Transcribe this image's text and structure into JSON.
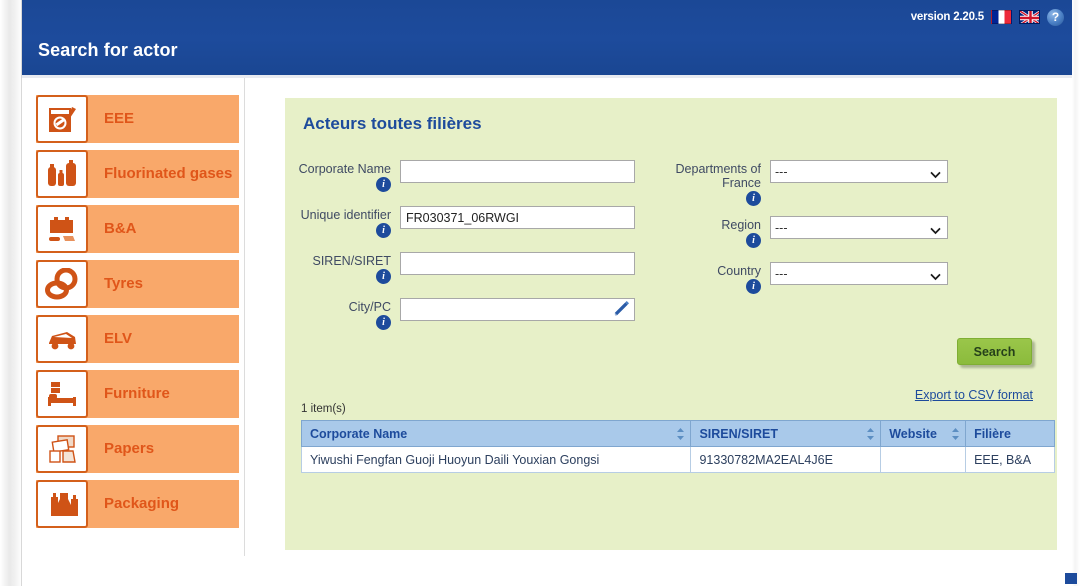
{
  "header": {
    "version_text": "version 2.20.5",
    "title": "Search for actor",
    "flag_fr_name": "french-flag-icon",
    "flag_uk_name": "uk-flag-icon",
    "help_glyph": "?"
  },
  "sidebar": {
    "items": [
      {
        "label": "EEE",
        "icon": "washing-machine-icon"
      },
      {
        "label": "Fluorinated gases",
        "icon": "gas-cylinder-icon"
      },
      {
        "label": "B&A",
        "icon": "battery-icon"
      },
      {
        "label": "Tyres",
        "icon": "tyre-icon"
      },
      {
        "label": "ELV",
        "icon": "car-icon"
      },
      {
        "label": "Furniture",
        "icon": "bed-icon"
      },
      {
        "label": "Papers",
        "icon": "paper-icon"
      },
      {
        "label": "Packaging",
        "icon": "bottles-icon"
      }
    ]
  },
  "panel": {
    "title": "Acteurs toutes filières",
    "fields_left": [
      {
        "label": "Corporate Name",
        "value": "",
        "placeholder": ""
      },
      {
        "label": "Unique identifier",
        "value": "FR030371_06RWGI",
        "placeholder": ""
      },
      {
        "label": "SIREN/SIRET",
        "value": "",
        "placeholder": ""
      },
      {
        "label": "City/PC",
        "value": "",
        "placeholder": ""
      }
    ],
    "fields_right": [
      {
        "label": "Departments of France",
        "value": "---"
      },
      {
        "label": "Region",
        "value": "---"
      },
      {
        "label": "Country",
        "value": "---"
      }
    ],
    "select_options": [
      "---"
    ],
    "search_label": "Search",
    "export_label": "Export to CSV format",
    "item_count": "1 item(s)"
  },
  "table": {
    "columns": [
      {
        "label": "Corporate Name",
        "sortable": true
      },
      {
        "label": "SIREN/SIRET",
        "sortable": true
      },
      {
        "label": "Website",
        "sortable": true
      },
      {
        "label": "Filière",
        "sortable": false
      }
    ],
    "rows": [
      {
        "name": "Yiwushi Fengfan Guoji Huoyun Daili Youxian Gongsi",
        "siret": "91330782MA2EAL4J6E",
        "website": "",
        "filiere": "EEE, B&A"
      }
    ]
  },
  "colors": {
    "header_blue": "#1d4b9c",
    "panel_green": "#e7f0c8",
    "sidebar_orange": "#f9a86a",
    "sidebar_orange_text": "#e0561a",
    "table_header_blue": "#a9c9ea",
    "search_green": "#8bbb3c"
  }
}
